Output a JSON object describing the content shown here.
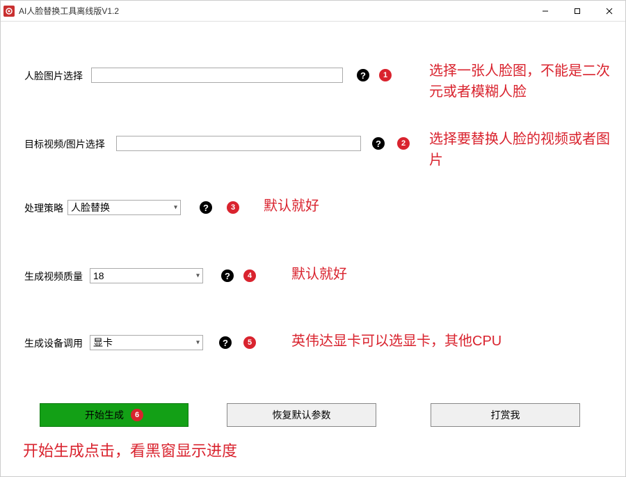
{
  "window": {
    "title": "AI人脸替换工具离线版V1.2"
  },
  "rows": {
    "face_select": {
      "label": "人脸图片选择",
      "value": "",
      "badge": "1",
      "hint": "选择一张人脸图，不能是二次元或者模糊人脸"
    },
    "target_select": {
      "label": "目标视频/图片选择",
      "value": "",
      "badge": "2",
      "hint": "选择要替换人脸的视频或者图片"
    },
    "strategy": {
      "label": "处理策略",
      "value": "人脸替换",
      "badge": "3",
      "hint": "默认就好"
    },
    "quality": {
      "label": "生成视频质量",
      "value": "18",
      "badge": "4",
      "hint": "默认就好"
    },
    "device": {
      "label": "生成设备调用",
      "value": "显卡",
      "badge": "5",
      "hint": "英伟达显卡可以选显卡，其他CPU"
    }
  },
  "buttons": {
    "start": {
      "label": "开始生成",
      "badge": "6"
    },
    "reset": {
      "label": "恢复默认参数"
    },
    "donate": {
      "label": "打赏我"
    }
  },
  "footer_hint": "开始生成点击，看黑窗显示进度",
  "help_glyph": "?"
}
